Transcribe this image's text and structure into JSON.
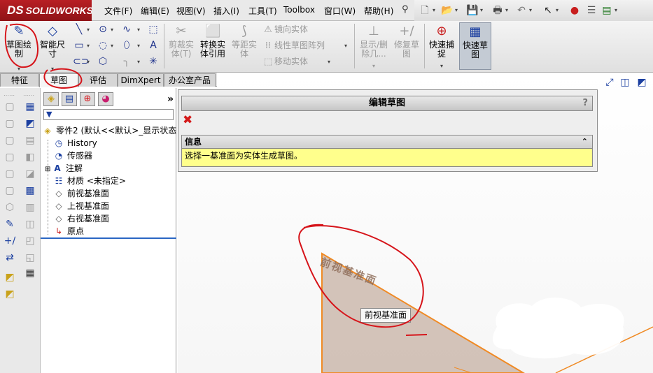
{
  "app": {
    "brand": "SOLIDWORKS",
    "brand_mark": "DS"
  },
  "menu": {
    "items": [
      "文件(F)",
      "编辑(E)",
      "视图(V)",
      "插入(I)",
      "工具(T)",
      "Toolbox",
      "窗口(W)",
      "帮助(H)"
    ]
  },
  "toolbar": {
    "sketch_label": "草图绘制",
    "smart_dim_label": "智能尺寸",
    "trim_label": "剪裁实体(T)",
    "convert_label": "转换实体引用",
    "offset_label": "等距实体",
    "mirror_label": "镜向实体",
    "linear_pattern_label": "线性草图阵列",
    "move_label": "移动实体",
    "show_delete_label": "显示/删除几...",
    "repair_label": "修复草图",
    "quick_snap_label": "快速捕捉",
    "rapid_sketch_label": "快速草图"
  },
  "tabs": [
    "特征",
    "草图",
    "评估",
    "DimXpert",
    "办公室产品"
  ],
  "active_tab": "草图",
  "feature_tree": {
    "root": "零件2  (默认<<默认>_显示状态",
    "items": [
      "History",
      "传感器",
      "注解",
      "材质 <未指定>",
      "前视基准面",
      "上视基准面",
      "右视基准面",
      "原点"
    ]
  },
  "property_manager": {
    "title": "编辑草图",
    "help": "?",
    "info_title": "信息",
    "info_text": "选择一基准面为实体生成草图。"
  },
  "graphics": {
    "plane_label": "前视基准面",
    "tooltip": "前视基准面",
    "plane_color": "#c9b5a9",
    "edge_color": "#f08a24"
  },
  "colors": {
    "annotation_red": "#d6141a",
    "info_yellow": "#ffff8c",
    "brand_red": "#b81f24"
  }
}
